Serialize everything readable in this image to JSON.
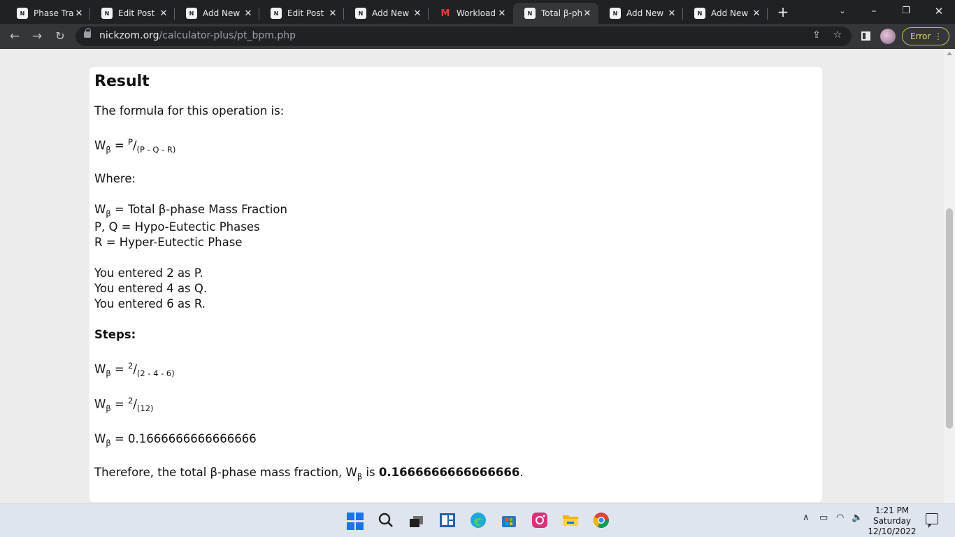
{
  "tabs": [
    {
      "title": "Phase Tran",
      "favicon": "N",
      "active": false
    },
    {
      "title": "Edit Post ‹",
      "favicon": "N",
      "active": false
    },
    {
      "title": "Add New P",
      "favicon": "N",
      "active": false
    },
    {
      "title": "Edit Post ‹",
      "favicon": "N",
      "active": false
    },
    {
      "title": "Add New P",
      "favicon": "N",
      "active": false
    },
    {
      "title": "Workload",
      "favicon": "M",
      "active": false
    },
    {
      "title": "Total β-pha",
      "favicon": "N",
      "active": true
    },
    {
      "title": "Add New P",
      "favicon": "N",
      "active": false
    },
    {
      "title": "Add New P",
      "favicon": "N",
      "active": false
    }
  ],
  "address": {
    "host": "nickzom.org",
    "path": "/calculator-plus/pt_bpm.php"
  },
  "toolbar": {
    "error_label": "Error"
  },
  "result": {
    "heading": "Result",
    "formula_intro": "The formula for this operation is:",
    "formula": {
      "lhs": "W",
      "sub": "β",
      "num": "P",
      "den": "(P - Q - R)"
    },
    "where_label": "Where:",
    "definitions": [
      {
        "symbol": "W",
        "sub": "β",
        "text": " = Total β-phase Mass Fraction"
      },
      {
        "symbol": "P, Q",
        "sub": "",
        "text": " = Hypo-Eutectic Phases"
      },
      {
        "symbol": "R",
        "sub": "",
        "text": " = Hyper-Eutectic Phase"
      }
    ],
    "entered": [
      "You entered 2 as P.",
      "You entered 4 as Q.",
      "You entered 6 as R."
    ],
    "steps_label": "Steps:",
    "steps": [
      {
        "lhs": "W",
        "sub": "β",
        "num": "2",
        "den": "(2 - 4 - 6)"
      },
      {
        "lhs": "W",
        "sub": "β",
        "num": "2",
        "den": "(12)"
      },
      {
        "lhs": "W",
        "sub": "β",
        "value": "0.1666666666666666"
      }
    ],
    "conclusion_prefix": "Therefore, the total β-phase mass fraction, W",
    "conclusion_sub": "β",
    "conclusion_mid": " is ",
    "conclusion_value": "0.1666666666666666",
    "conclusion_end": "."
  },
  "taskbar": {
    "time": "1:21 PM",
    "day": "Saturday",
    "date": "12/10/2022"
  }
}
